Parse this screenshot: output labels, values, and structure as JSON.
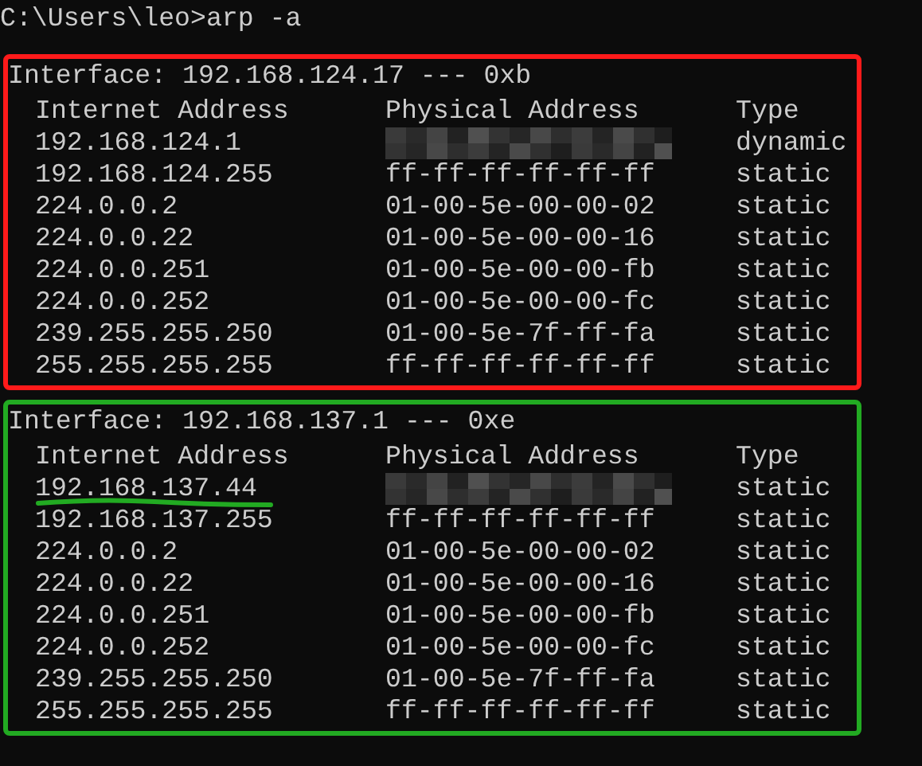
{
  "prompt": "C:\\Users\\leo>arp -a",
  "interfaces": [
    {
      "header": "Interface: 192.168.124.17 --- 0xb",
      "color": "#ff1a1a",
      "columns": [
        "Internet Address",
        "Physical Address",
        "Type"
      ],
      "rows": [
        {
          "internet_address": "192.168.124.1",
          "redacted": true,
          "type": "dynamic",
          "underlined": false
        },
        {
          "internet_address": "192.168.124.255",
          "physical_address": "ff-ff-ff-ff-ff-ff",
          "redacted": false,
          "type": "static",
          "underlined": false
        },
        {
          "internet_address": "224.0.0.2",
          "physical_address": "01-00-5e-00-00-02",
          "redacted": false,
          "type": "static",
          "underlined": false
        },
        {
          "internet_address": "224.0.0.22",
          "physical_address": "01-00-5e-00-00-16",
          "redacted": false,
          "type": "static",
          "underlined": false
        },
        {
          "internet_address": "224.0.0.251",
          "physical_address": "01-00-5e-00-00-fb",
          "redacted": false,
          "type": "static",
          "underlined": false
        },
        {
          "internet_address": "224.0.0.252",
          "physical_address": "01-00-5e-00-00-fc",
          "redacted": false,
          "type": "static",
          "underlined": false
        },
        {
          "internet_address": "239.255.255.250",
          "physical_address": "01-00-5e-7f-ff-fa",
          "redacted": false,
          "type": "static",
          "underlined": false
        },
        {
          "internet_address": "255.255.255.255",
          "physical_address": "ff-ff-ff-ff-ff-ff",
          "redacted": false,
          "type": "static",
          "underlined": false
        }
      ]
    },
    {
      "header": "Interface: 192.168.137.1 --- 0xe",
      "color": "#22aa22",
      "columns": [
        "Internet Address",
        "Physical Address",
        "Type"
      ],
      "rows": [
        {
          "internet_address": "192.168.137.44",
          "redacted": true,
          "type": "static",
          "underlined": true
        },
        {
          "internet_address": "192.168.137.255",
          "physical_address": "ff-ff-ff-ff-ff-ff",
          "redacted": false,
          "type": "static",
          "underlined": false
        },
        {
          "internet_address": "224.0.0.2",
          "physical_address": "01-00-5e-00-00-02",
          "redacted": false,
          "type": "static",
          "underlined": false
        },
        {
          "internet_address": "224.0.0.22",
          "physical_address": "01-00-5e-00-00-16",
          "redacted": false,
          "type": "static",
          "underlined": false
        },
        {
          "internet_address": "224.0.0.251",
          "physical_address": "01-00-5e-00-00-fb",
          "redacted": false,
          "type": "static",
          "underlined": false
        },
        {
          "internet_address": "224.0.0.252",
          "physical_address": "01-00-5e-00-00-fc",
          "redacted": false,
          "type": "static",
          "underlined": false
        },
        {
          "internet_address": "239.255.255.250",
          "physical_address": "01-00-5e-7f-ff-fa",
          "redacted": false,
          "type": "static",
          "underlined": false
        },
        {
          "internet_address": "255.255.255.255",
          "physical_address": "ff-ff-ff-ff-ff-ff",
          "redacted": false,
          "type": "static",
          "underlined": false
        }
      ]
    }
  ]
}
